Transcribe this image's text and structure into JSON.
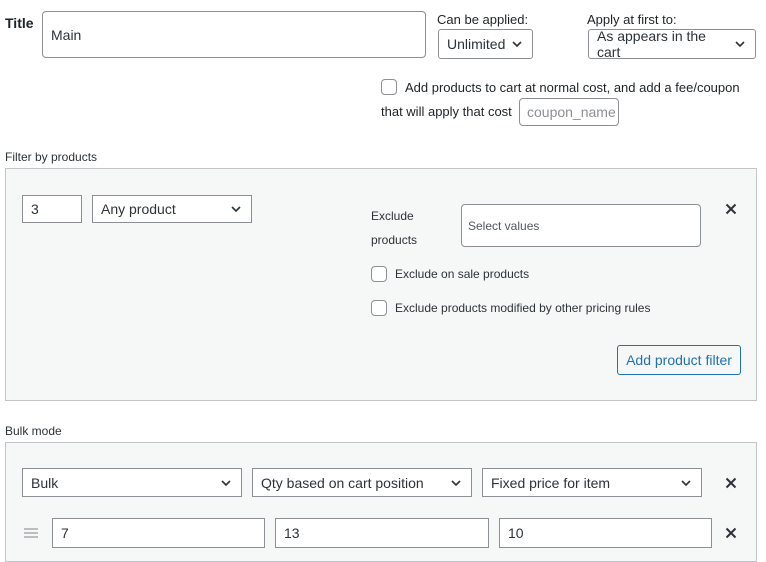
{
  "title_row": {
    "title_label": "Title",
    "title_value": "Main",
    "can_be_applied_label": "Can be applied:",
    "can_be_applied_value": "Unlimited",
    "apply_first_label": "Apply at first to:",
    "apply_first_value": "As appears in the cart"
  },
  "fee_option": {
    "line1": "Add products to cart at normal cost, and add a fee/coupon",
    "line2": "that will apply that cost",
    "coupon_placeholder": "coupon_name"
  },
  "filter": {
    "section_label": "Filter by products",
    "qty_value": "3",
    "product_type": "Any product",
    "exclude_label_1": "Exclude",
    "exclude_label_2": "products",
    "exclude_placeholder": "Select values",
    "exclude_on_sale": "Exclude on sale products",
    "exclude_modified": "Exclude products modified by other pricing rules",
    "add_filter_button": "Add product filter"
  },
  "bulk": {
    "section_label": "Bulk mode",
    "mode_value": "Bulk",
    "qty_basis_value": "Qty based on cart position",
    "price_type_value": "Fixed price for item",
    "range_row": {
      "from": "7",
      "to": "13",
      "price": "10"
    }
  },
  "icons": {
    "close": "close-icon",
    "chevron": "chevron-down-icon",
    "drag": "drag-handle-icon"
  },
  "colors": {
    "accent": "#2271b1",
    "border": "#8c8f94",
    "panel_bg": "#f6f7f7"
  }
}
